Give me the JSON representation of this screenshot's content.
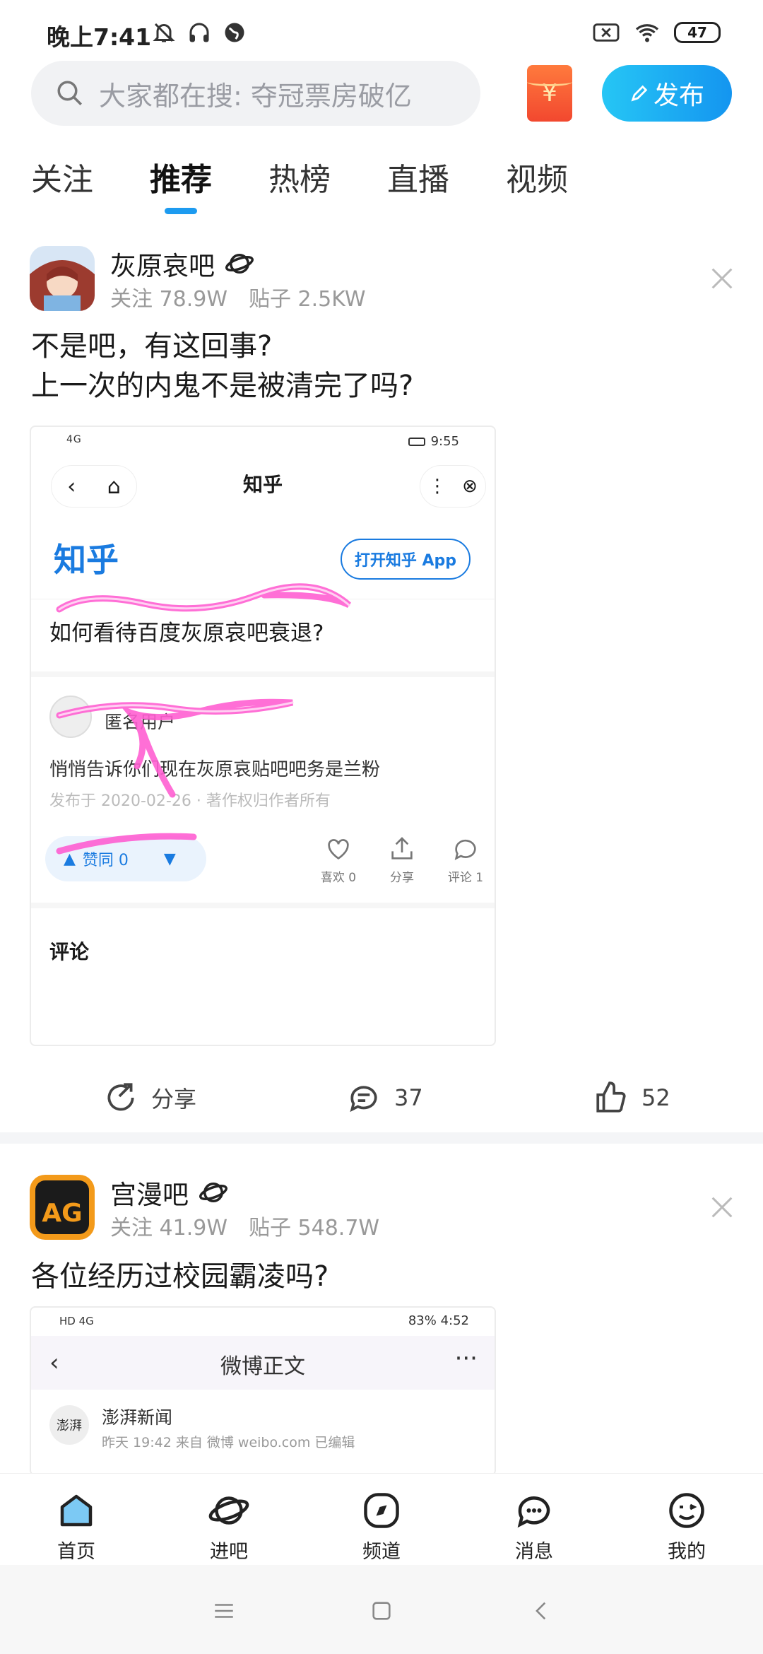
{
  "status_bar": {
    "time": "晚上7:41",
    "battery": "47"
  },
  "search": {
    "placeholder": "大家都在搜: 夺冠票房破亿"
  },
  "redpacket_icon": "¥",
  "publish_button": "发布",
  "tabs": [
    {
      "label": "关注",
      "active": false
    },
    {
      "label": "推荐",
      "active": true
    },
    {
      "label": "热榜",
      "active": false
    },
    {
      "label": "直播",
      "active": false
    },
    {
      "label": "视频",
      "active": false
    }
  ],
  "posts": [
    {
      "forum": "灰原哀吧",
      "follow": "关注 78.9W",
      "threads": "贴子 2.5KW",
      "title_lines": [
        "不是吧，有这回事?",
        "上一次的内鬼不是被清完了吗?"
      ],
      "shot": {
        "status_left": "4G",
        "status_right": "9:55",
        "nav_title": "知乎",
        "logo": "知乎",
        "open_app": "打开知乎 App",
        "question": "如何看待百度灰原哀吧衰退?",
        "user": "匿名用户",
        "body": "悄悄告诉你们现在灰原哀贴吧吧务是兰粉",
        "date": "发布于 2020-02-26 · 著作权归作者所有",
        "vote": "赞同 0",
        "like": "喜欢 0",
        "share": "分享",
        "comment": "评论 1",
        "comments_header": "评论"
      },
      "actions": {
        "share": "分享",
        "comments": "37",
        "likes": "52"
      }
    },
    {
      "forum": "宫漫吧",
      "follow": "关注 41.9W",
      "threads": "贴子 548.7W",
      "title_lines": [
        "各位经历过校园霸凌吗?"
      ],
      "shot": {
        "status_left": "HD 4G",
        "status_right": "83%  4:52",
        "nav_title": "微博正文",
        "more": "···",
        "user": "澎湃新闻",
        "avatar_text": "澎湃",
        "meta": "昨天 19:42 来自 微博 weibo.com 已编辑"
      }
    }
  ],
  "bottom_nav": [
    {
      "label": "首页",
      "icon": "home-icon"
    },
    {
      "label": "进吧",
      "icon": "planet-icon"
    },
    {
      "label": "频道",
      "icon": "compass-icon"
    },
    {
      "label": "消息",
      "icon": "message-icon"
    },
    {
      "label": "我的",
      "icon": "profile-face-icon"
    }
  ],
  "colors": {
    "accent": "#1d9bf0",
    "doodle": "#ff5fd2"
  }
}
